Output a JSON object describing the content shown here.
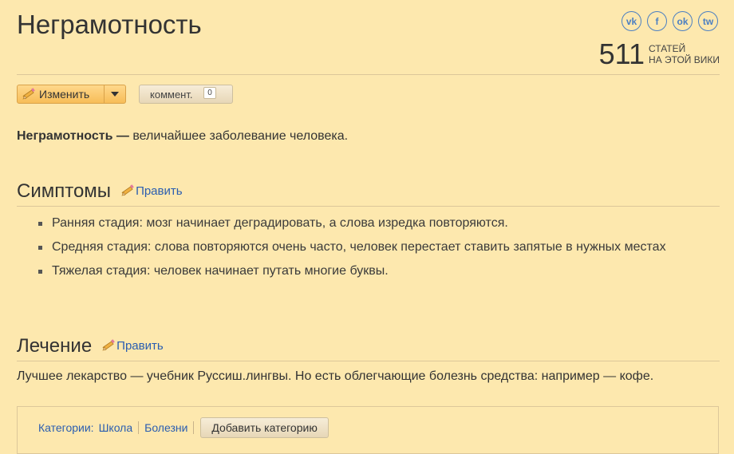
{
  "page": {
    "title": "Неграмотность"
  },
  "social": {
    "vk": "vk",
    "facebook": "f",
    "ok": "ok",
    "twitter": "tw"
  },
  "counter": {
    "number": "511",
    "line1": "СТАТЕЙ",
    "line2": "НА ЭТОЙ ВИКИ"
  },
  "toolbar": {
    "edit_label": "Изменить",
    "comment_label": "коммент.",
    "comment_count": "0"
  },
  "intro": {
    "bold": "Неграмотность —",
    "text": " величайшее заболевание человека."
  },
  "sections": [
    {
      "title": "Симптомы",
      "edit_label": "Править"
    },
    {
      "title": "Лечение",
      "edit_label": "Править"
    }
  ],
  "symptoms": [
    "Ранняя стадия: мозг начинает деградировать, а слова изредка повторяются.",
    "Средняя стадия: слова повторяются очень часто, человек перестает ставить запятые в нужных местах",
    "Тяжелая стадия: человек начинает путать многие буквы."
  ],
  "treatment": "Лучшее лекарство — учебник Руссиш.лингвы. Но есть облегчающие болезнь средства: например — кофе.",
  "categories": {
    "label": "Категории:",
    "items": [
      "Школа",
      "Болезни"
    ],
    "add_label": "Добавить категорию"
  },
  "colors": {
    "background": "#fde8ae",
    "link": "#2a5db0",
    "accent_button": "#f7bd58"
  }
}
